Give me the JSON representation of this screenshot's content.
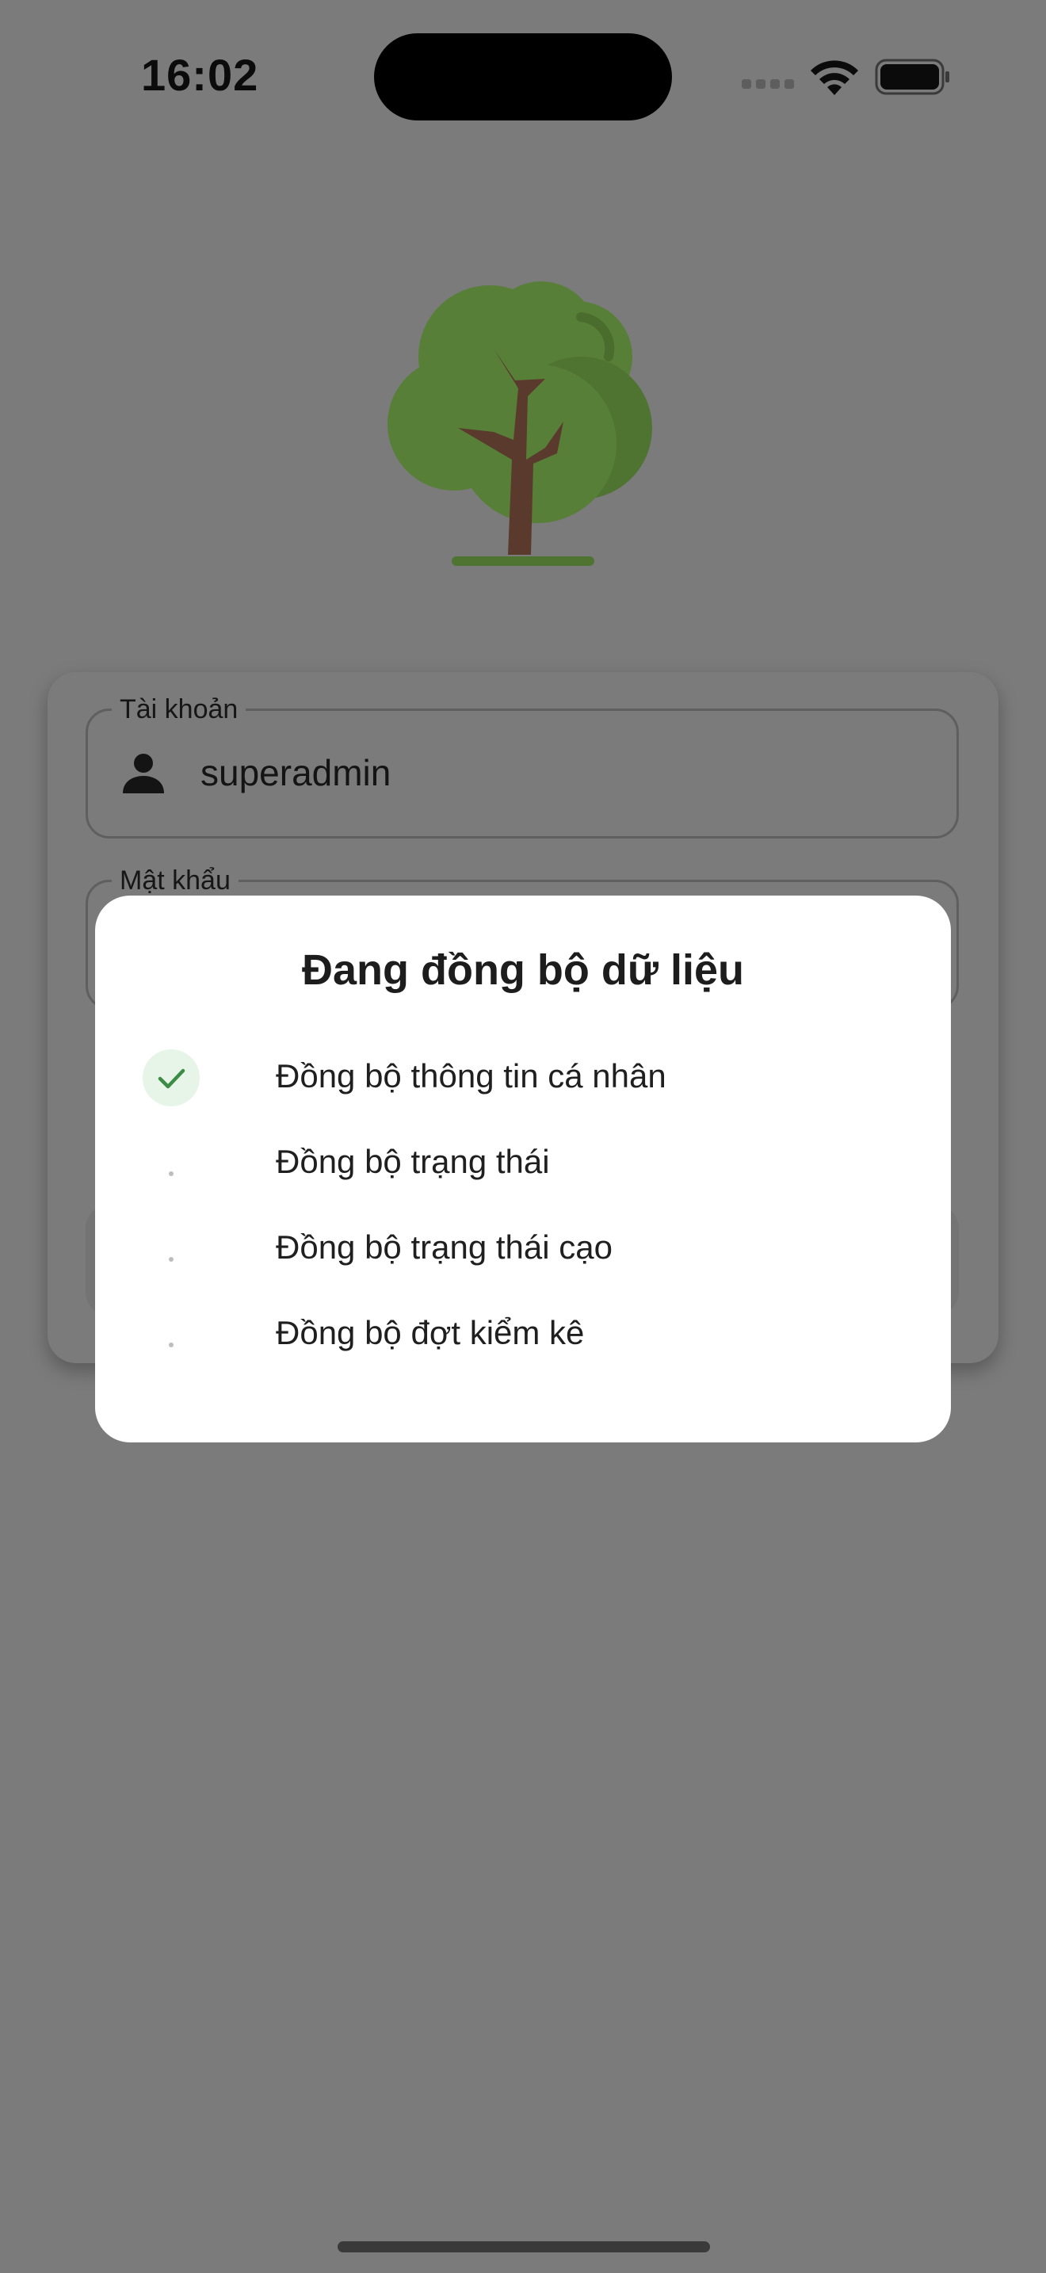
{
  "status_bar": {
    "time": "16:02",
    "icons": [
      "cellular-signal-icon",
      "wifi-icon",
      "battery-icon"
    ]
  },
  "logo": {
    "icon": "tree-logo-icon"
  },
  "login_form": {
    "username": {
      "label": "Tài khoản",
      "value": "superadmin",
      "icon": "person-icon"
    },
    "password": {
      "label": "Mật khẩu"
    }
  },
  "sync_dialog": {
    "title": "Đang đồng bộ dữ liệu",
    "steps": [
      {
        "label": "Đồng bộ thông tin cá nhân",
        "status": "done"
      },
      {
        "label": "Đồng bộ trạng thái",
        "status": "loading"
      },
      {
        "label": "Đồng bộ trạng thái cạo",
        "status": "loading"
      },
      {
        "label": "Đồng bộ đợt kiểm kê",
        "status": "loading"
      }
    ]
  },
  "colors": {
    "overlay": "#7b7b7b",
    "dialog_bg": "#ffffff",
    "done_check": "#3c8c45",
    "done_bg": "#e7f5e9",
    "tree_foliage": "#5b8a3c",
    "tree_trunk": "#5a3a2c"
  }
}
